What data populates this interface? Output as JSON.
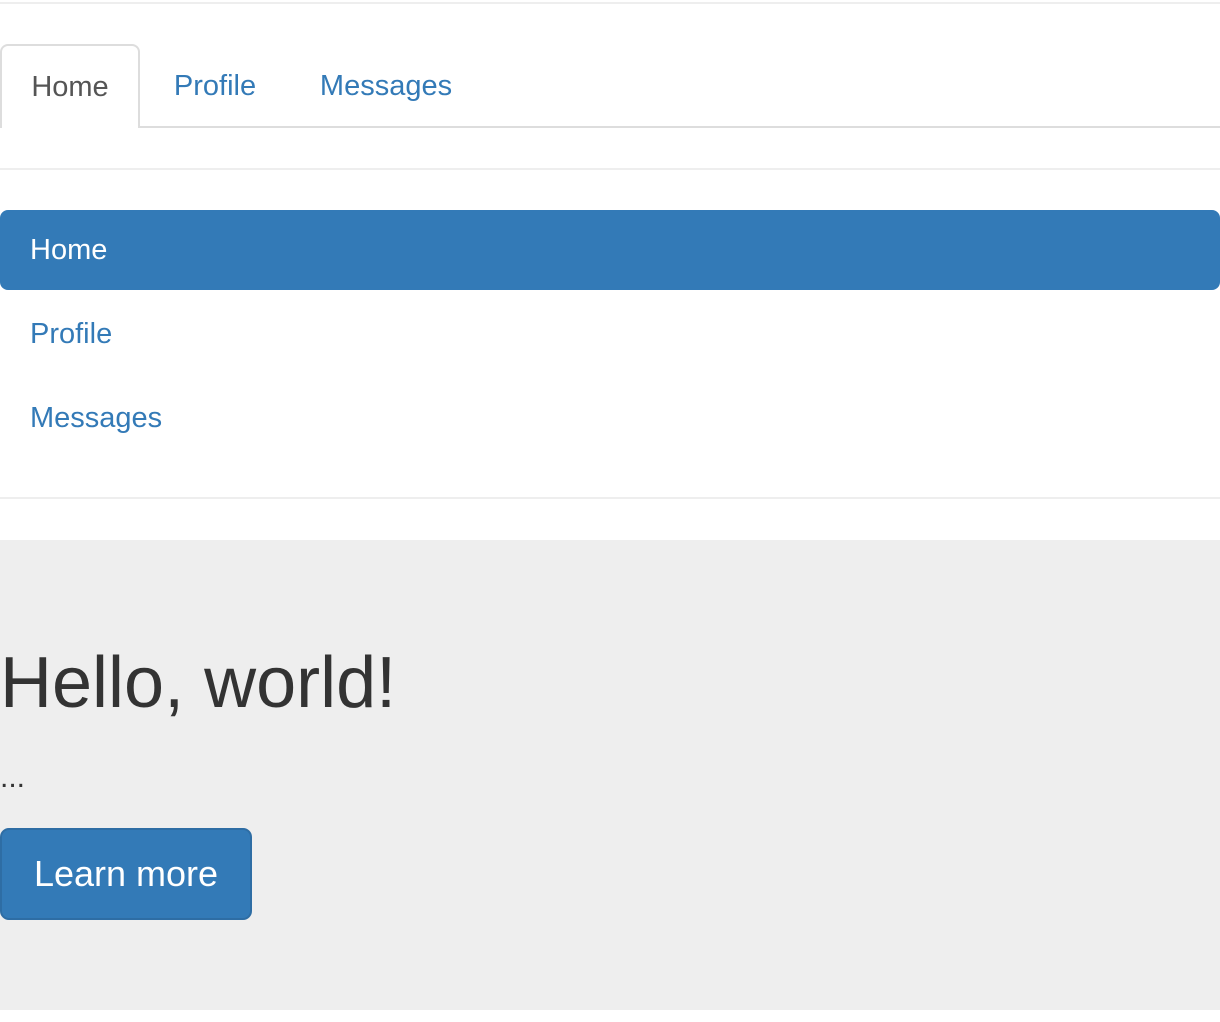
{
  "tabs": {
    "items": [
      {
        "label": "Home",
        "active": true
      },
      {
        "label": "Profile",
        "active": false
      },
      {
        "label": "Messages",
        "active": false
      }
    ]
  },
  "pills": {
    "items": [
      {
        "label": "Home",
        "active": true
      },
      {
        "label": "Profile",
        "active": false
      },
      {
        "label": "Messages",
        "active": false
      }
    ]
  },
  "jumbotron": {
    "heading": "Hello, world!",
    "text": "...",
    "button_label": "Learn more"
  },
  "colors": {
    "primary": "#337ab7",
    "jumbotron_background": "#eeeeee",
    "active_tab_text": "#555555"
  }
}
